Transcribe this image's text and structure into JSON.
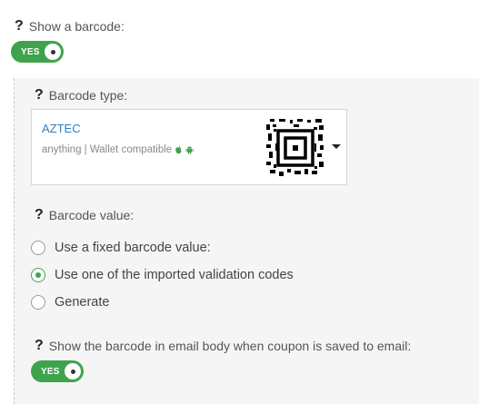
{
  "show_barcode": {
    "question_mark": "?",
    "label": "Show a barcode:",
    "toggle_text": "YES"
  },
  "barcode_type": {
    "question_mark": "?",
    "label": "Barcode type:",
    "selected_name": "AZTEC",
    "selected_desc": "anything | Wallet compatible"
  },
  "barcode_value": {
    "question_mark": "?",
    "label": "Barcode value:",
    "options": [
      {
        "label": "Use a fixed barcode value:",
        "checked": false
      },
      {
        "label": "Use one of the imported validation codes",
        "checked": true
      },
      {
        "label": "Generate",
        "checked": false
      }
    ]
  },
  "email_body": {
    "question_mark": "?",
    "label": "Show the barcode in email body when coupon is saved to email:",
    "toggle_text": "YES"
  },
  "colors": {
    "accent": "#3fa34d",
    "link": "#2f7fc1",
    "panel_bg": "#f5f5f5"
  }
}
